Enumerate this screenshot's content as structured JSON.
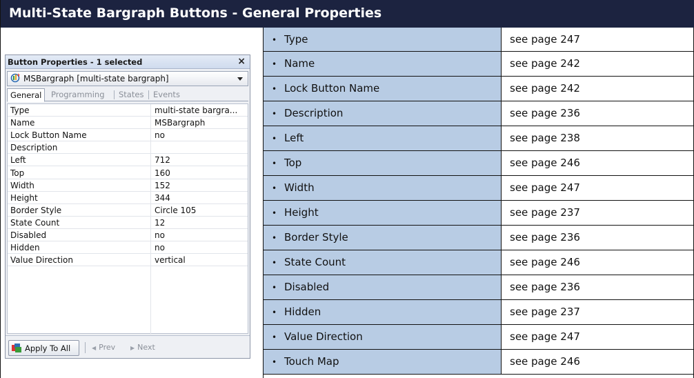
{
  "title": "Multi-State Bargraph Buttons - General Properties",
  "panel": {
    "header": "Button Properties - 1 selected",
    "close_glyph": "×",
    "selector": {
      "text": "MSBargraph  [multi-state bargraph]",
      "icon": "bargraph-button-icon"
    },
    "tabs": [
      "General",
      "Programming",
      "States",
      "Events"
    ],
    "active_tab": "General",
    "properties": [
      {
        "key": "Type",
        "value": "multi-state bargra..."
      },
      {
        "key": "Name",
        "value": "MSBargraph"
      },
      {
        "key": "Lock Button Name",
        "value": "no"
      },
      {
        "key": "Description",
        "value": ""
      },
      {
        "key": "Left",
        "value": "712"
      },
      {
        "key": "Top",
        "value": "160"
      },
      {
        "key": "Width",
        "value": "152"
      },
      {
        "key": "Height",
        "value": "344"
      },
      {
        "key": "Border Style",
        "value": "Circle 105"
      },
      {
        "key": "State Count",
        "value": "12"
      },
      {
        "key": "Disabled",
        "value": "no"
      },
      {
        "key": "Hidden",
        "value": "no"
      },
      {
        "key": "Value Direction",
        "value": "vertical"
      }
    ],
    "footer": {
      "apply_label": "Apply To All",
      "prev_label": "Prev",
      "next_label": "Next"
    }
  },
  "reference_table": [
    {
      "label": "Type",
      "page": "see page 247"
    },
    {
      "label": "Name",
      "page": "see page 242"
    },
    {
      "label": "Lock Button Name",
      "page": "see page 242"
    },
    {
      "label": "Description",
      "page": "see page 236"
    },
    {
      "label": "Left",
      "page": "see page 238"
    },
    {
      "label": "Top",
      "page": "see page 246"
    },
    {
      "label": "Width",
      "page": "see page 247"
    },
    {
      "label": "Height",
      "page": "see page 237"
    },
    {
      "label": "Border Style",
      "page": "see page 236"
    },
    {
      "label": "State Count",
      "page": "see page 246"
    },
    {
      "label": "Disabled",
      "page": "see page 236"
    },
    {
      "label": "Hidden",
      "page": "see page 237"
    },
    {
      "label": "Value Direction",
      "page": "see page 247"
    },
    {
      "label": "Touch Map",
      "page": "see page 246"
    }
  ],
  "colors": {
    "title_bg": "#1c2340",
    "label_cell_bg": "#b8cce4"
  }
}
